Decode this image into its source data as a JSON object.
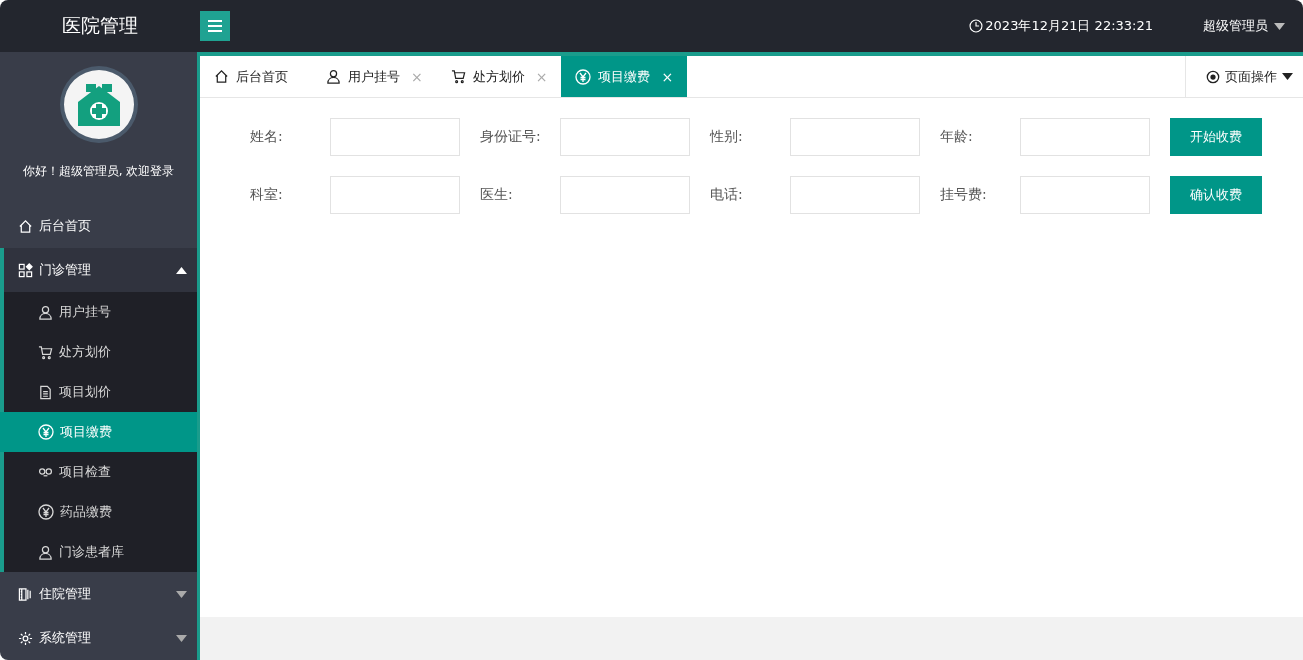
{
  "header": {
    "title": "医院管理",
    "clock": "2023年12月21日 22:33:21",
    "user": "超级管理员"
  },
  "sidebar": {
    "welcome": "你好！超级管理员, 欢迎登录",
    "items": [
      {
        "label": "后台首页"
      },
      {
        "label": "门诊管理",
        "expanded": true,
        "children": [
          {
            "label": "用户挂号",
            "selected": false
          },
          {
            "label": "处方划价",
            "selected": false
          },
          {
            "label": "项目划价",
            "selected": false
          },
          {
            "label": "项目缴费",
            "selected": true
          },
          {
            "label": "项目检查",
            "selected": false
          },
          {
            "label": "药品缴费",
            "selected": false
          },
          {
            "label": "门诊患者库",
            "selected": false
          }
        ]
      },
      {
        "label": "住院管理",
        "expanded": false
      },
      {
        "label": "系统管理",
        "expanded": false
      }
    ]
  },
  "tabs": [
    {
      "label": "后台首页",
      "selected": false
    },
    {
      "label": "用户挂号",
      "selected": false,
      "close": "×"
    },
    {
      "label": "处方划价",
      "selected": false,
      "close": "×"
    },
    {
      "label": "项目缴费",
      "selected": true,
      "close": "×"
    }
  ],
  "page_ops": "页面操作",
  "form": {
    "fields": [
      {
        "label": "姓名:"
      },
      {
        "label": "身份证号:"
      },
      {
        "label": "性别:"
      },
      {
        "label": "年龄:"
      },
      {
        "label": "科室:"
      },
      {
        "label": "医生:"
      },
      {
        "label": "电话:"
      },
      {
        "label": "挂号费:"
      }
    ],
    "buttons": [
      "开始收费",
      "确认收费"
    ]
  }
}
